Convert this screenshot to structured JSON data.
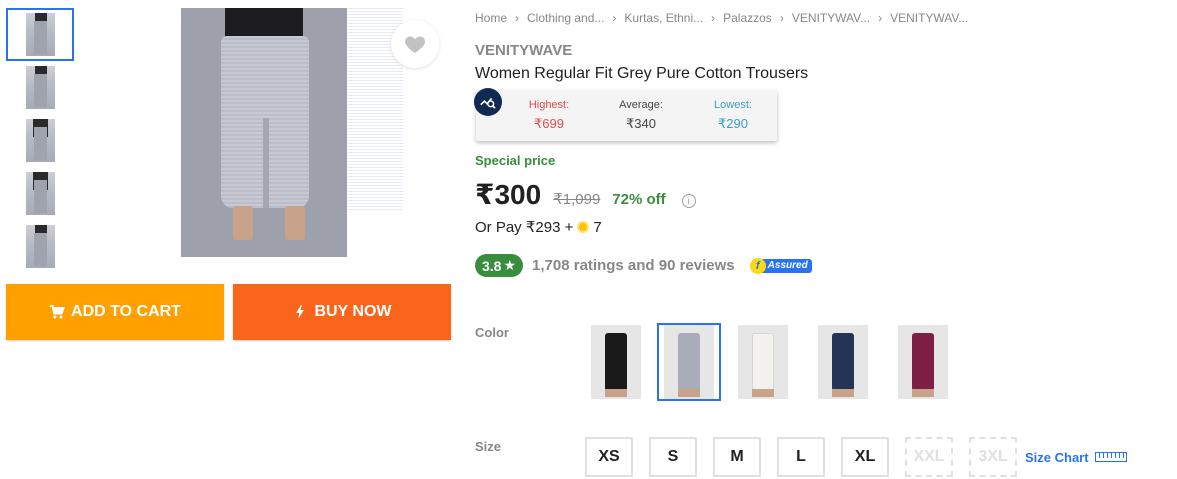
{
  "gallery": {
    "thumbnail_count": 5,
    "selected_index": 0
  },
  "actions": {
    "add_to_cart": "ADD TO CART",
    "buy_now": "BUY NOW"
  },
  "breadcrumb": [
    "Home",
    "Clothing and...",
    "Kurtas, Ethni...",
    "Palazzos",
    "VENITYWAV...",
    "VENITYWAV..."
  ],
  "product": {
    "brand": "VENITYWAVE",
    "title": "Women Regular Fit Grey Pure Cotton Trousers",
    "special_label": "Special price",
    "price": "₹300",
    "mrp": "₹1,099",
    "discount": "72% off",
    "or_pay_prefix": "Or Pay ₹293 +",
    "or_pay_coins": "7"
  },
  "price_tracker": {
    "highest_label": "Highest:",
    "highest_value": "₹699",
    "average_label": "Average:",
    "average_value": "₹340",
    "lowest_label": "Lowest:",
    "lowest_value": "₹290"
  },
  "rating": {
    "value": "3.8",
    "star": "★",
    "summary": "1,708 ratings and 90 reviews",
    "assured_letter": "f",
    "assured_label": "Assured"
  },
  "color": {
    "label": "Color",
    "swatches": [
      {
        "name": "black",
        "hex": "#1a1a1a",
        "selected": false
      },
      {
        "name": "grey",
        "hex": "#a9adb9",
        "selected": true
      },
      {
        "name": "white",
        "hex": "#f3f1ee",
        "selected": false
      },
      {
        "name": "navy",
        "hex": "#243457",
        "selected": false
      },
      {
        "name": "maroon",
        "hex": "#7e1f45",
        "selected": false
      }
    ]
  },
  "size": {
    "label": "Size",
    "options": [
      "XS",
      "S",
      "M",
      "L",
      "XL",
      "XXL",
      "3XL"
    ],
    "unavailable": [
      "XXL",
      "3XL"
    ],
    "chart_label": "Size Chart"
  },
  "colors": {
    "cart_button": "#ff9f00",
    "buy_button": "#fb641b",
    "accent": "#2874f0",
    "green": "#388e3c"
  }
}
